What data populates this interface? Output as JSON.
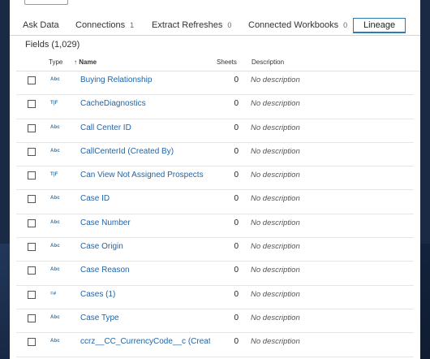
{
  "tabs": [
    {
      "label": "Ask Data",
      "count": ""
    },
    {
      "label": "Connections",
      "count": "1"
    },
    {
      "label": "Extract Refreshes",
      "count": "0"
    },
    {
      "label": "Connected Workbooks",
      "count": "0"
    },
    {
      "label": "Lineage",
      "count": ""
    }
  ],
  "fields": {
    "title": "Fields (1,029)",
    "columns": {
      "type": "Type",
      "name": "↑ Name",
      "sheets": "Sheets",
      "description": "Description"
    },
    "rows": [
      {
        "type_icon": "Abc",
        "name": "Buying Relationship",
        "sheets": "0",
        "description": "No description"
      },
      {
        "type_icon": "T|F",
        "name": "CacheDiagnostics",
        "sheets": "0",
        "description": "No description"
      },
      {
        "type_icon": "Abc",
        "name": "Call Center ID",
        "sheets": "0",
        "description": "No description"
      },
      {
        "type_icon": "Abc",
        "name": "CallCenterId (Created By)",
        "sheets": "0",
        "description": "No description"
      },
      {
        "type_icon": "T|F",
        "name": "Can View Not Assigned Prospects",
        "sheets": "0",
        "description": "No description"
      },
      {
        "type_icon": "Abc",
        "name": "Case ID",
        "sheets": "0",
        "description": "No description"
      },
      {
        "type_icon": "Abc",
        "name": "Case Number",
        "sheets": "0",
        "description": "No description"
      },
      {
        "type_icon": "Abc",
        "name": "Case Origin",
        "sheets": "0",
        "description": "No description"
      },
      {
        "type_icon": "Abc",
        "name": "Case Reason",
        "sheets": "0",
        "description": "No description"
      },
      {
        "type_icon": "=#",
        "name": "Cases (1)",
        "sheets": "0",
        "description": "No description"
      },
      {
        "type_icon": "Abc",
        "name": "Case Type",
        "sheets": "0",
        "description": "No description"
      },
      {
        "type_icon": "Abc",
        "name": "ccrz__CC_CurrencyCode__c (Create",
        "sheets": "0",
        "description": "No description"
      }
    ]
  }
}
